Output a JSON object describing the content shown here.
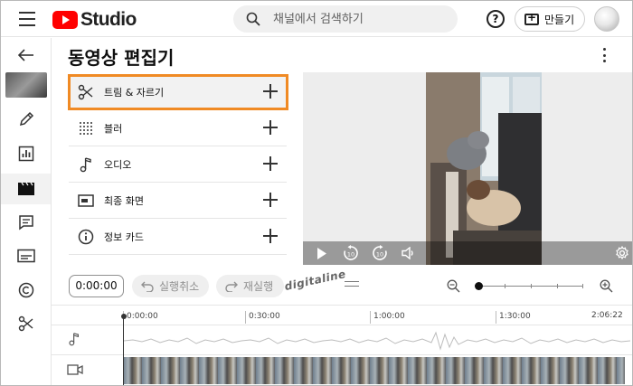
{
  "header": {
    "logo_text": "Studio",
    "search_placeholder": "채널에서 검색하기",
    "help_label": "?",
    "create_label": "만들기"
  },
  "page": {
    "title": "동영상 편집기"
  },
  "tools": [
    {
      "label": "트림 & 자르기",
      "icon": "scissors-icon"
    },
    {
      "label": "블러",
      "icon": "blur-grid-icon"
    },
    {
      "label": "오디오",
      "icon": "music-note-icon"
    },
    {
      "label": "최종 화면",
      "icon": "end-screen-icon"
    },
    {
      "label": "정보 카드",
      "icon": "info-icon"
    }
  ],
  "toolbar": {
    "timecode": "0:00:00",
    "undo_label": "실행취소",
    "redo_label": "재실행"
  },
  "watermark": "digitaline",
  "timeline": {
    "ticks": [
      "0:00:00",
      "0:30:00",
      "1:00:00",
      "1:30:00"
    ],
    "end_time": "2:06:22"
  },
  "video_controls": {
    "rewind_label": "10",
    "forward_label": "10"
  },
  "colors": {
    "brand": "#ff0000",
    "highlight": "#f08a24"
  }
}
